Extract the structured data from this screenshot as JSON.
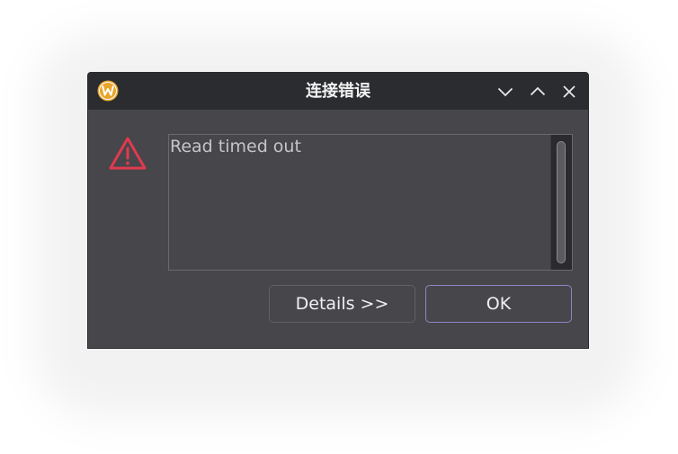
{
  "window": {
    "title": "连接错误"
  },
  "message": {
    "text": "Read timed out"
  },
  "buttons": {
    "details": "Details >>",
    "ok": "OK"
  },
  "colors": {
    "titlebar": "#2b2c30",
    "body": "#47464b",
    "warning": "#e03a4f",
    "app_icon": "#e8a42a",
    "ok_border": "#8e86c4"
  },
  "icons": {
    "app": "app-logo-icon",
    "minimize": "chevron-down-icon",
    "maximize": "chevron-up-icon",
    "close": "close-icon",
    "warning": "warning-icon"
  }
}
